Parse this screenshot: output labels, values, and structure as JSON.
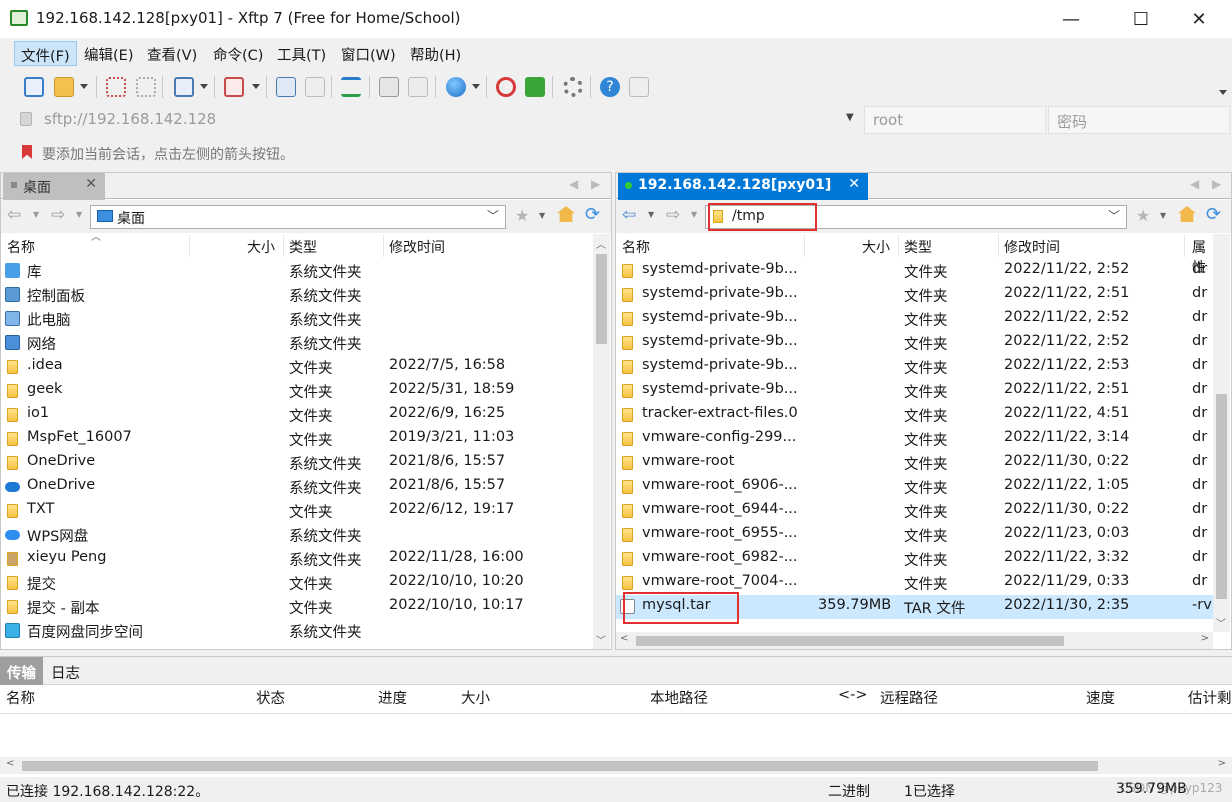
{
  "window": {
    "title": "192.168.142.128[pxy01]  - Xftp 7 (Free for Home/School)",
    "minimize": "—",
    "maximize": "☐",
    "close": "✕"
  },
  "menu": [
    "文件(F)",
    "编辑(E)",
    "查看(V)",
    "命令(C)",
    "工具(T)",
    "窗口(W)",
    "帮助(H)"
  ],
  "address": {
    "url": "sftp://192.168.142.128",
    "user": "root",
    "password_placeholder": "密码"
  },
  "hint": "要添加当前会话，点击左侧的箭头按钮。",
  "left_pane": {
    "tab": "桌面",
    "path": "桌面",
    "columns": [
      "名称",
      "大小",
      "类型",
      "修改时间"
    ],
    "rows": [
      {
        "name": "库",
        "size": "",
        "type": "系统文件夹",
        "time": "",
        "icon": "library-icon"
      },
      {
        "name": "控制面板",
        "size": "",
        "type": "系统文件夹",
        "time": "",
        "icon": "control-panel-icon"
      },
      {
        "name": "此电脑",
        "size": "",
        "type": "系统文件夹",
        "time": "",
        "icon": "computer-icon"
      },
      {
        "name": "网络",
        "size": "",
        "type": "系统文件夹",
        "time": "",
        "icon": "network-icon"
      },
      {
        "name": ".idea",
        "size": "",
        "type": "文件夹",
        "time": "2022/7/5, 16:58",
        "icon": "folder-icon"
      },
      {
        "name": "geek",
        "size": "",
        "type": "文件夹",
        "time": "2022/5/31, 18:59",
        "icon": "folder-icon"
      },
      {
        "name": "io1",
        "size": "",
        "type": "文件夹",
        "time": "2022/6/9, 16:25",
        "icon": "folder-icon"
      },
      {
        "name": "MspFet_16007",
        "size": "",
        "type": "文件夹",
        "time": "2019/3/21, 11:03",
        "icon": "folder-icon"
      },
      {
        "name": "OneDrive",
        "size": "",
        "type": "系统文件夹",
        "time": "2021/8/6, 15:57",
        "icon": "folder-icon"
      },
      {
        "name": "OneDrive",
        "size": "",
        "type": "系统文件夹",
        "time": "2021/8/6, 15:57",
        "icon": "cloud-icon"
      },
      {
        "name": "TXT",
        "size": "",
        "type": "文件夹",
        "time": "2022/6/12, 19:17",
        "icon": "folder-icon"
      },
      {
        "name": "WPS网盘",
        "size": "",
        "type": "系统文件夹",
        "time": "",
        "icon": "cloud-icon"
      },
      {
        "name": "xieyu Peng",
        "size": "",
        "type": "系统文件夹",
        "time": "2022/11/28, 16:00",
        "icon": "user-folder-icon"
      },
      {
        "name": "提交",
        "size": "",
        "type": "文件夹",
        "time": "2022/10/10, 10:20",
        "icon": "folder-icon"
      },
      {
        "name": "提交 - 副本",
        "size": "",
        "type": "文件夹",
        "time": "2022/10/10, 10:17",
        "icon": "folder-icon"
      },
      {
        "name": "百度网盘同步空间",
        "size": "",
        "type": "系统文件夹",
        "time": "",
        "icon": "sync-folder-icon"
      }
    ]
  },
  "right_pane": {
    "tab": "192.168.142.128[pxy01]",
    "path": "/tmp",
    "columns": [
      "名称",
      "大小",
      "类型",
      "修改时间",
      "属性"
    ],
    "rows": [
      {
        "name": "systemd-private-9b...",
        "size": "",
        "type": "文件夹",
        "time": "2022/11/22, 2:52",
        "attr": "dr"
      },
      {
        "name": "systemd-private-9b...",
        "size": "",
        "type": "文件夹",
        "time": "2022/11/22, 2:51",
        "attr": "dr"
      },
      {
        "name": "systemd-private-9b...",
        "size": "",
        "type": "文件夹",
        "time": "2022/11/22, 2:52",
        "attr": "dr"
      },
      {
        "name": "systemd-private-9b...",
        "size": "",
        "type": "文件夹",
        "time": "2022/11/22, 2:52",
        "attr": "dr"
      },
      {
        "name": "systemd-private-9b...",
        "size": "",
        "type": "文件夹",
        "time": "2022/11/22, 2:53",
        "attr": "dr"
      },
      {
        "name": "systemd-private-9b...",
        "size": "",
        "type": "文件夹",
        "time": "2022/11/22, 2:51",
        "attr": "dr"
      },
      {
        "name": "tracker-extract-files.0",
        "size": "",
        "type": "文件夹",
        "time": "2022/11/22, 4:51",
        "attr": "dr"
      },
      {
        "name": "vmware-config-299...",
        "size": "",
        "type": "文件夹",
        "time": "2022/11/22, 3:14",
        "attr": "dr"
      },
      {
        "name": "vmware-root",
        "size": "",
        "type": "文件夹",
        "time": "2022/11/30, 0:22",
        "attr": "dr"
      },
      {
        "name": "vmware-root_6906-...",
        "size": "",
        "type": "文件夹",
        "time": "2022/11/22, 1:05",
        "attr": "dr"
      },
      {
        "name": "vmware-root_6944-...",
        "size": "",
        "type": "文件夹",
        "time": "2022/11/30, 0:22",
        "attr": "dr"
      },
      {
        "name": "vmware-root_6955-...",
        "size": "",
        "type": "文件夹",
        "time": "2022/11/23, 0:03",
        "attr": "dr"
      },
      {
        "name": "vmware-root_6982-...",
        "size": "",
        "type": "文件夹",
        "time": "2022/11/22, 3:32",
        "attr": "dr"
      },
      {
        "name": "vmware-root_7004-...",
        "size": "",
        "type": "文件夹",
        "time": "2022/11/29, 0:33",
        "attr": "dr"
      },
      {
        "name": "mysql.tar",
        "size": "359.79MB",
        "type": "TAR 文件",
        "time": "2022/11/30, 2:35",
        "attr": "-rv",
        "selected": true
      }
    ]
  },
  "transfer": {
    "tabs": [
      "传输",
      "日志"
    ],
    "columns": [
      "名称",
      "状态",
      "进度",
      "大小",
      "本地路径",
      "<->",
      "远程路径",
      "速度",
      "估计剩"
    ]
  },
  "status": {
    "connection": "已连接 192.168.142.128:22。",
    "mode": "二进制",
    "selection": "1已选择",
    "size": "359.79MB",
    "watermark": "CSDN @pxyp123"
  },
  "colors": {
    "selection": "#cce8ff",
    "highlight_box": "#e03030",
    "active_tab": "#0078d7"
  }
}
